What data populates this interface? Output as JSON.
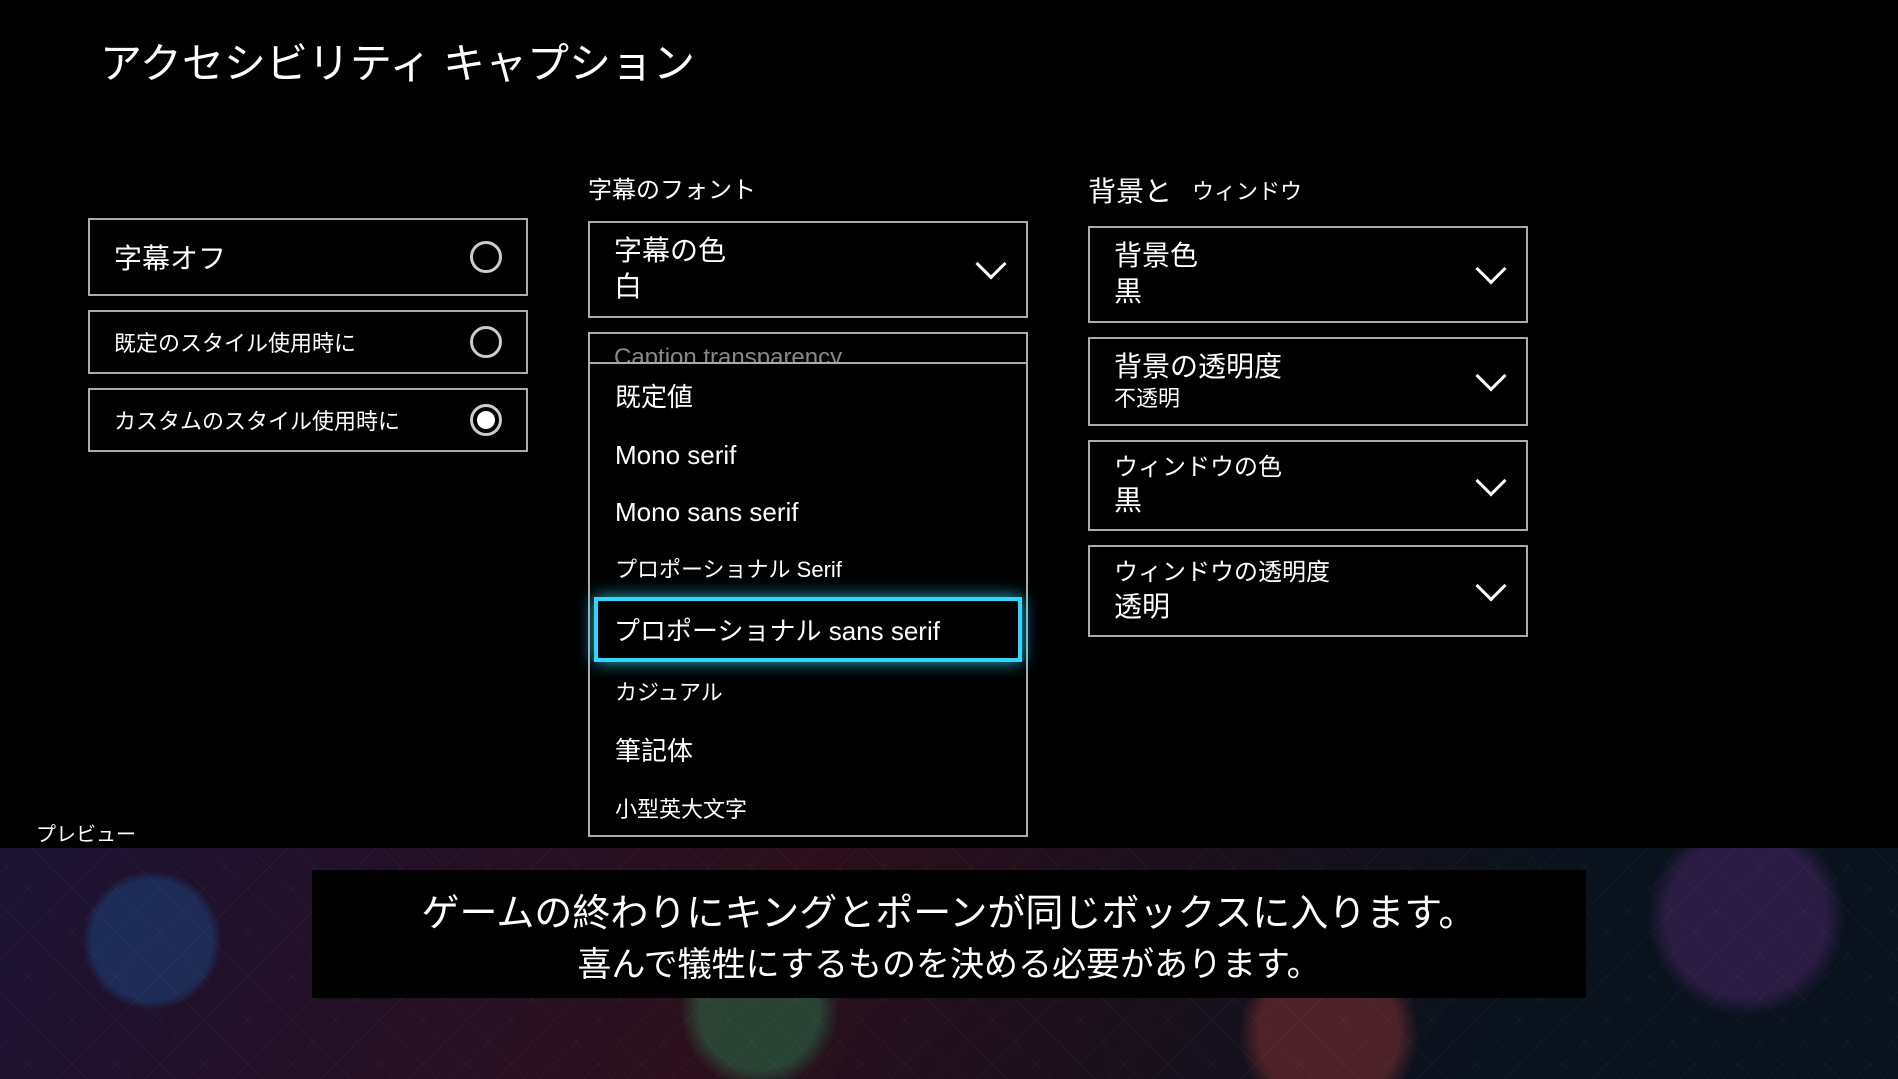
{
  "page_title": "アクセシビリティ キャプション",
  "left": {
    "opt_off": "字幕オフ",
    "opt_default": "既定のスタイル使用時に",
    "opt_custom": "カスタムのスタイル使用時に"
  },
  "mid": {
    "header": "字幕のフォント",
    "caption_color": {
      "title": "字幕の色",
      "value": "白"
    },
    "hidden_dd_title": "Caption transparency",
    "menu": {
      "default": "既定値",
      "mono_serif": "Mono serif",
      "mono_sans": "Mono sans serif",
      "prop_serif": "プロポーショナル Serif",
      "prop_sans": "プロポーショナル sans serif",
      "casual": "カジュアル",
      "cursive": "筆記体",
      "small_caps": "小型英大文字"
    }
  },
  "right": {
    "header_main": "背景と",
    "header_sub": "ウィンドウ",
    "bg_color": {
      "title": "背景色",
      "value": "黒"
    },
    "bg_trans": {
      "title": "背景の透明度",
      "value": "不透明"
    },
    "win_color": {
      "title": "ウィンドウの色",
      "value": "黒"
    },
    "win_trans": {
      "title": "ウィンドウの透明度",
      "value": "透明"
    }
  },
  "preview_label": "プレビュー",
  "caption_line1": "ゲームの終わりにキングとポーンが同じボックスに入ります。",
  "caption_line2": "喜んで犠牲にするものを決める必要があります。"
}
